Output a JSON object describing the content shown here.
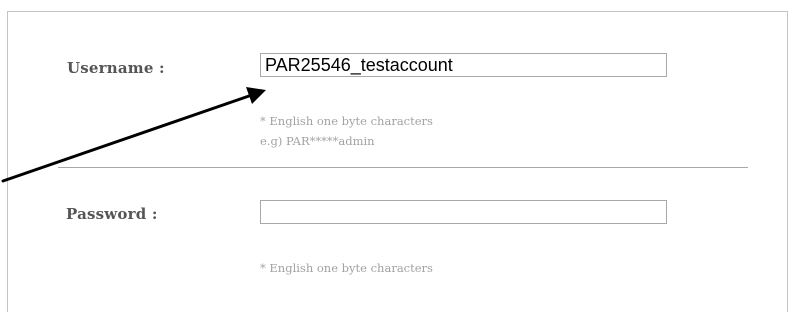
{
  "form": {
    "username": {
      "label": "Username :",
      "value": "PAR25546_testaccount",
      "hint_1": "* English one byte characters",
      "hint_2": "e.g) PAR*****admin"
    },
    "password": {
      "label": "Password :",
      "value": "",
      "hint_1": "* English one byte characters"
    }
  },
  "annotation": {
    "arrow_color": "#000000",
    "icon": "arrow-icon"
  }
}
